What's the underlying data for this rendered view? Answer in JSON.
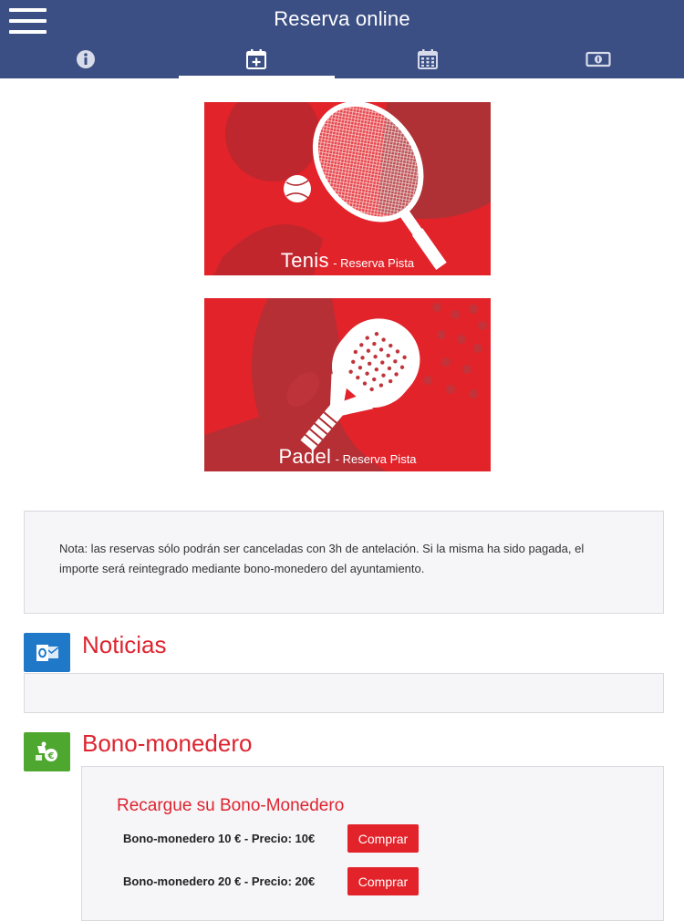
{
  "header": {
    "title": "Reserva online",
    "menu_icon": "hamburger-menu-icon",
    "background": "#3b4f84"
  },
  "tabs": [
    {
      "icon": "info-icon",
      "active": false
    },
    {
      "icon": "calendar-plus-icon",
      "active": true
    },
    {
      "icon": "calendar-grid-icon",
      "active": false
    },
    {
      "icon": "money-icon",
      "active": false
    }
  ],
  "banners": {
    "tenis": {
      "title": "Tenis",
      "subtitle": "- Reserva Pista"
    },
    "padel": {
      "title": "Padel",
      "subtitle": "- Reserva Pista"
    },
    "color": "#e2232a"
  },
  "note": {
    "text": "Nota: las reservas sólo podrán ser canceladas con 3h de antelación. Si la misma ha sido pagada, el importe será reintegrado mediante bono-monedero del ayuntamiento."
  },
  "news": {
    "title": "Noticias",
    "icon": "outlook-mail-icon",
    "icon_color": "#1f78c8"
  },
  "bono": {
    "title": "Bono-monedero",
    "icon": "wallet-coins-icon",
    "icon_color": "#4ea72e",
    "heading": "Recargue su Bono-Monedero",
    "products": [
      {
        "label": "Bono-monedero 10 € - Precio: 10€",
        "button": "Comprar"
      },
      {
        "label": "Bono-monedero 20 € - Precio: 20€",
        "button": "Comprar"
      }
    ]
  },
  "accent_color": "#dd2430"
}
